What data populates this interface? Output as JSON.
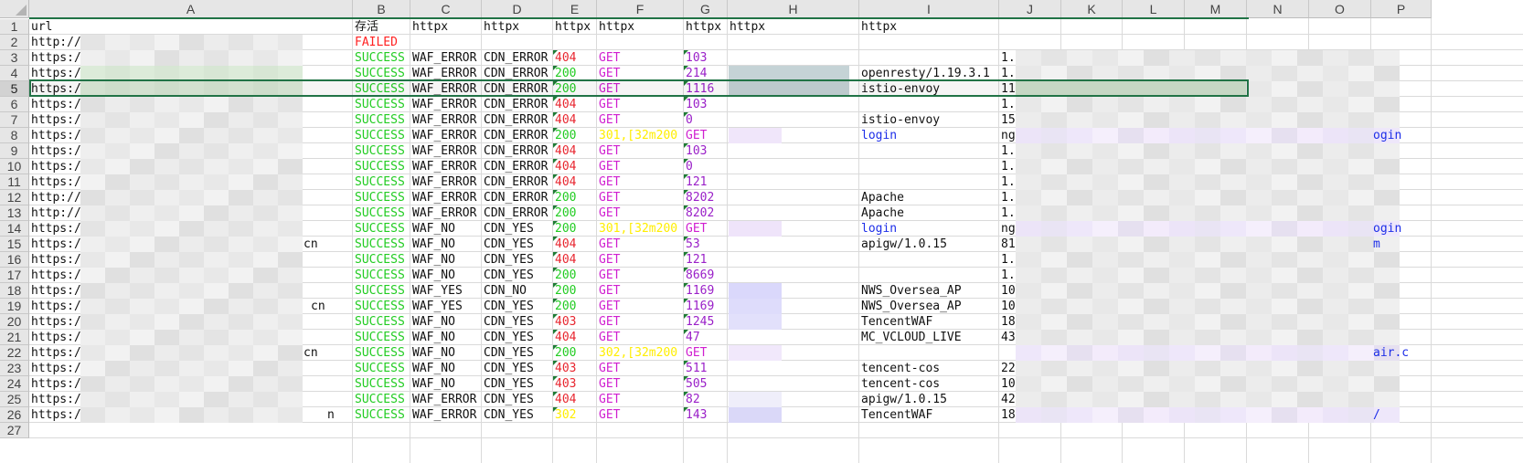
{
  "columns": [
    "A",
    "B",
    "C",
    "D",
    "E",
    "F",
    "G",
    "H",
    "I",
    "J",
    "K",
    "L",
    "M",
    "N",
    "O",
    "P"
  ],
  "selected_row": 5,
  "colors": {
    "success": "#22cc22",
    "failed": "#ff2222",
    "status_red": "#e8262f",
    "status_green": "#22cc22",
    "status_yellow": "#ffee00",
    "get": "#d020d0",
    "purple": "#9a20c8",
    "blue": "#1d2ee8",
    "selection": "#217346"
  },
  "header_row": {
    "A": "url",
    "B": "存活",
    "C": "httpx",
    "D": "httpx",
    "E": "httpx",
    "F": "httpx",
    "G": "httpx",
    "H": "httpx",
    "I": "httpx"
  },
  "rows": [
    {
      "num": "2",
      "A": "http://",
      "B": "FAILED",
      "C": "",
      "D": "",
      "E": "",
      "F": "",
      "G": "",
      "I": "",
      "J": "",
      "P": ""
    },
    {
      "num": "3",
      "A": "https:/",
      "B": "SUCCESS",
      "C": "WAF_ERROR",
      "D": "CDN_ERROR",
      "E": "404",
      "F": "GET",
      "G": "103",
      "I": "",
      "J": "1.",
      "P": ""
    },
    {
      "num": "4",
      "A": "https:/",
      "B": "SUCCESS",
      "C": "WAF_ERROR",
      "D": "CDN_ERROR",
      "E": "200",
      "F": "GET",
      "G": "214",
      "I": "openresty/1.19.3.1",
      "J": "1.",
      "P": ""
    },
    {
      "num": "5",
      "A": "https:/",
      "B": "SUCCESS",
      "C": "WAF_ERROR",
      "D": "CDN_ERROR",
      "E": "200",
      "F": "GET",
      "G": "1116",
      "I": "istio-envoy",
      "J": "11",
      "P": ""
    },
    {
      "num": "6",
      "A": "https:/",
      "B": "SUCCESS",
      "C": "WAF_ERROR",
      "D": "CDN_ERROR",
      "E": "404",
      "F": "GET",
      "G": "103",
      "I": "",
      "J": "1.",
      "P": ""
    },
    {
      "num": "7",
      "A": "https:/",
      "B": "SUCCESS",
      "C": "WAF_ERROR",
      "D": "CDN_ERROR",
      "E": "404",
      "F": "GET",
      "G": "0",
      "I": "istio-envoy",
      "J": "15",
      "P": ""
    },
    {
      "num": "8",
      "A": "https:/",
      "B": "SUCCESS",
      "C": "WAF_ERROR",
      "D": "CDN_ERROR",
      "E": "200",
      "F": "301,[32m200",
      "G": "GET",
      "I": "login",
      "J": "ng",
      "P": "ogin"
    },
    {
      "num": "9",
      "A": "https:/",
      "B": "SUCCESS",
      "C": "WAF_ERROR",
      "D": "CDN_ERROR",
      "E": "404",
      "F": "GET",
      "G": "103",
      "I": "",
      "J": "1.",
      "P": ""
    },
    {
      "num": "10",
      "A": "https:/",
      "B": "SUCCESS",
      "C": "WAF_ERROR",
      "D": "CDN_ERROR",
      "E": "404",
      "F": "GET",
      "G": "0",
      "I": "",
      "J": "1.",
      "P": ""
    },
    {
      "num": "11",
      "A": "https:/",
      "B": "SUCCESS",
      "C": "WAF_ERROR",
      "D": "CDN_ERROR",
      "E": "404",
      "F": "GET",
      "G": "121",
      "I": "",
      "J": "1.",
      "P": ""
    },
    {
      "num": "12",
      "A": "http://",
      "B": "SUCCESS",
      "C": "WAF_ERROR",
      "D": "CDN_ERROR",
      "E": "200",
      "F": "GET",
      "G": "8202",
      "I": "Apache",
      "J": "1.",
      "P": ""
    },
    {
      "num": "13",
      "A": "http://",
      "B": "SUCCESS",
      "C": "WAF_ERROR",
      "D": "CDN_ERROR",
      "E": "200",
      "F": "GET",
      "G": "8202",
      "I": "Apache",
      "J": "1.",
      "P": ""
    },
    {
      "num": "14",
      "A": "https:/",
      "B": "SUCCESS",
      "C": "WAF_NO",
      "D": "CDN_YES",
      "E": "200",
      "F": "301,[32m200",
      "G": "GET",
      "I": "login",
      "J": "ng",
      "P": "ogin"
    },
    {
      "num": "15",
      "A": "https:/",
      "B": "SUCCESS",
      "C": "WAF_NO",
      "D": "CDN_YES",
      "E": "404",
      "F": "GET",
      "G": "53",
      "I": "apigw/1.0.15",
      "J": "81",
      "P": "m",
      "Atail": "cn"
    },
    {
      "num": "16",
      "A": "https:/",
      "B": "SUCCESS",
      "C": "WAF_NO",
      "D": "CDN_YES",
      "E": "404",
      "F": "GET",
      "G": "121",
      "I": "",
      "J": "1.",
      "P": ""
    },
    {
      "num": "17",
      "A": "https:/",
      "B": "SUCCESS",
      "C": "WAF_NO",
      "D": "CDN_YES",
      "E": "200",
      "F": "GET",
      "G": "8669",
      "I": "",
      "J": "1.",
      "P": ""
    },
    {
      "num": "18",
      "A": "https:/",
      "B": "SUCCESS",
      "C": "WAF_YES",
      "D": "CDN_NO",
      "E": "200",
      "F": "GET",
      "G": "1169",
      "I": "NWS_Oversea_AP",
      "J": "10",
      "P": ""
    },
    {
      "num": "19",
      "A": "https:/",
      "B": "SUCCESS",
      "C": "WAF_YES",
      "D": "CDN_YES",
      "E": "200",
      "F": "GET",
      "G": "1169",
      "I": "NWS_Oversea_AP",
      "J": "10",
      "P": "",
      "Atail": "cn"
    },
    {
      "num": "20",
      "A": "https:/",
      "B": "SUCCESS",
      "C": "WAF_NO",
      "D": "CDN_YES",
      "E": "403",
      "F": "GET",
      "G": "1245",
      "I": "TencentWAF",
      "J": "18",
      "P": ""
    },
    {
      "num": "21",
      "A": "https:/",
      "B": "SUCCESS",
      "C": "WAF_NO",
      "D": "CDN_YES",
      "E": "404",
      "F": "GET",
      "G": "47",
      "I": "MC_VCLOUD_LIVE",
      "J": "43",
      "P": ""
    },
    {
      "num": "22",
      "A": "https:/",
      "B": "SUCCESS",
      "C": "WAF_NO",
      "D": "CDN_YES",
      "E": "200",
      "F": "302,[32m200",
      "G": "GET",
      "I": "",
      "J": "",
      "P": "air.c",
      "Atail": "cn"
    },
    {
      "num": "23",
      "A": "https:/",
      "B": "SUCCESS",
      "C": "WAF_NO",
      "D": "CDN_YES",
      "E": "403",
      "F": "GET",
      "G": "511",
      "I": "tencent-cos",
      "J": "22",
      "P": ""
    },
    {
      "num": "24",
      "A": "https:/",
      "B": "SUCCESS",
      "C": "WAF_NO",
      "D": "CDN_YES",
      "E": "403",
      "F": "GET",
      "G": "505",
      "I": "tencent-cos",
      "J": "10",
      "P": ""
    },
    {
      "num": "25",
      "A": "https:/",
      "B": "SUCCESS",
      "C": "WAF_ERROR",
      "D": "CDN_YES",
      "E": "404",
      "F": "GET",
      "G": "82",
      "I": "apigw/1.0.15",
      "J": "42",
      "P": ""
    },
    {
      "num": "26",
      "A": "https:/",
      "B": "SUCCESS",
      "C": "WAF_ERROR",
      "D": "CDN_YES",
      "E": "302",
      "F": "GET",
      "G": "143",
      "I": "TencentWAF",
      "J": "18",
      "P": "/",
      "Atail": "n"
    },
    {
      "num": "27",
      "A": "",
      "B": "",
      "C": "",
      "D": "",
      "E": "",
      "F": "",
      "G": "",
      "I": "",
      "J": "",
      "P": ""
    }
  ]
}
